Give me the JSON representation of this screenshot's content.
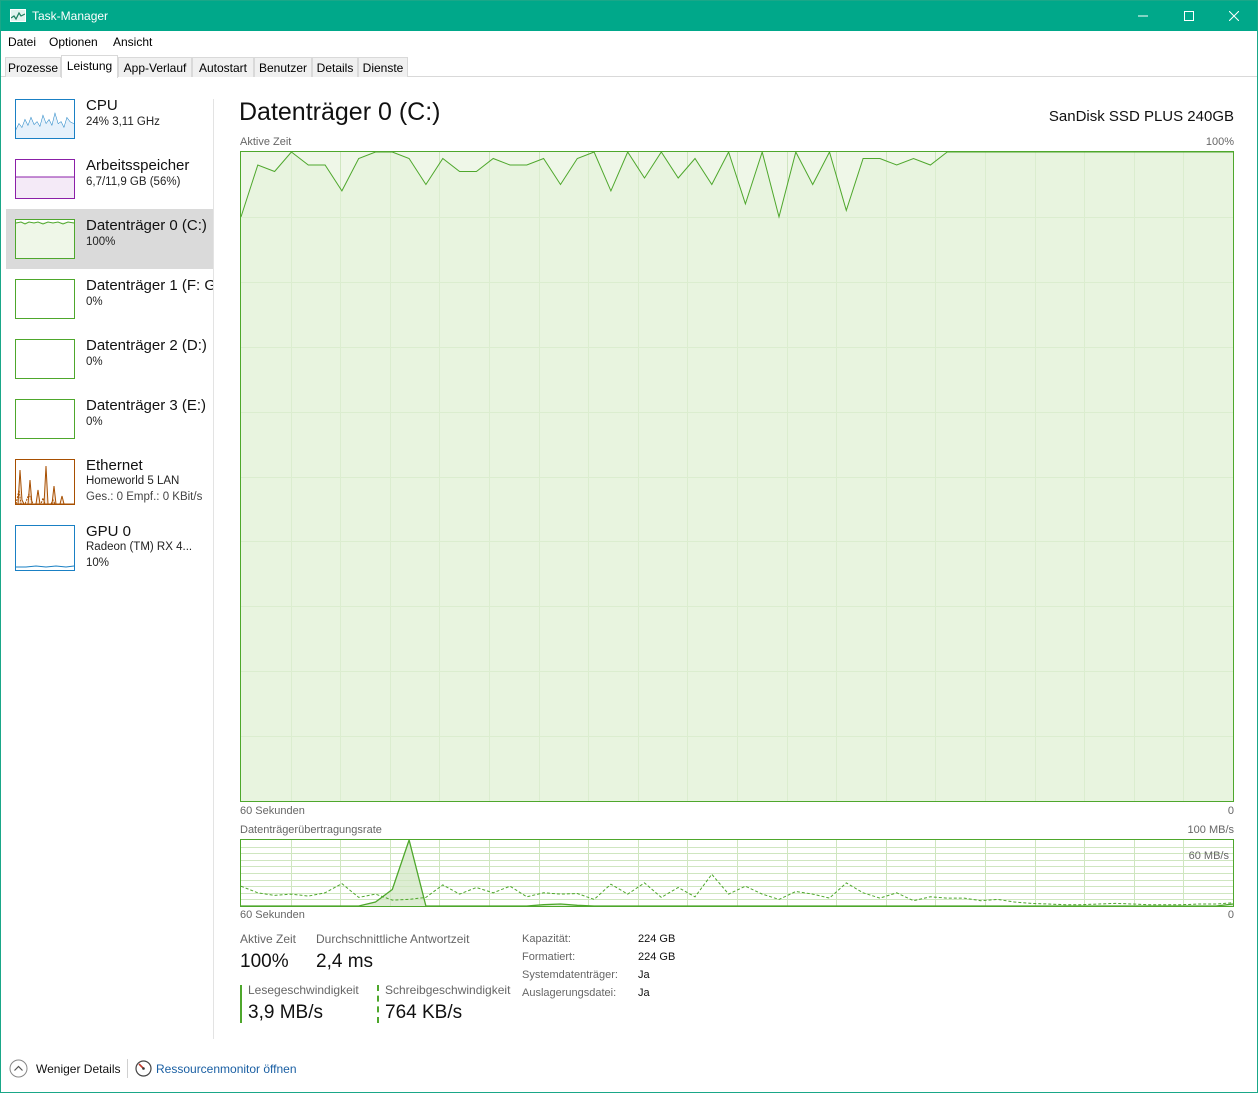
{
  "window": {
    "title": "Task-Manager"
  },
  "menu": [
    "Datei",
    "Optionen",
    "Ansicht"
  ],
  "tabs": [
    "Prozesse",
    "Leistung",
    "App-Verlauf",
    "Autostart",
    "Benutzer",
    "Details",
    "Dienste"
  ],
  "active_tab": "Leistung",
  "sidebar": [
    {
      "title": "CPU",
      "sub1": "24%  3,11 GHz",
      "sub2": "",
      "color": "#1a80c4"
    },
    {
      "title": "Arbeitsspeicher",
      "sub1": "6,7/11,9 GB (56%)",
      "sub2": "",
      "color": "#8b1fa8"
    },
    {
      "title": "Datenträger 0 (C:)",
      "sub1": "100%",
      "sub2": "",
      "color": "#4ea72c"
    },
    {
      "title": "Datenträger 1 (F: G",
      "sub1": "0%",
      "sub2": "",
      "color": "#4ea72c"
    },
    {
      "title": "Datenträger 2 (D:)",
      "sub1": "0%",
      "sub2": "",
      "color": "#4ea72c"
    },
    {
      "title": "Datenträger 3 (E:)",
      "sub1": "0%",
      "sub2": "",
      "color": "#4ea72c"
    },
    {
      "title": "Ethernet",
      "sub1": "Homeworld 5 LAN",
      "sub2": "Ges.: 0  Empf.: 0 KBit/s",
      "color": "#a74f01"
    },
    {
      "title": "GPU 0",
      "sub1": "Radeon (TM) RX 4...",
      "sub2": "10%",
      "color": "#1a80c4"
    }
  ],
  "main": {
    "title": "Datenträger 0 (C:)",
    "model": "SanDisk SSD PLUS 240GB",
    "chart1_label": "Aktive Zeit",
    "chart1_max": "100%",
    "chart1_xleft": "60 Sekunden",
    "chart1_xright": "0",
    "chart2_label": "Datenträgerübertragungsrate",
    "chart2_max": "100 MB/s",
    "chart2_mid": "60 MB/s",
    "chart2_xleft": "60 Sekunden",
    "chart2_xright": "0"
  },
  "stats": {
    "active_time_label": "Aktive Zeit",
    "active_time": "100%",
    "response_label": "Durchschnittliche Antwortzeit",
    "response": "2,4 ms",
    "read_label": "Lesegeschwindigkeit",
    "read": "3,9 MB/s",
    "write_label": "Schreibgeschwindigkeit",
    "write": "764 KB/s",
    "props": [
      {
        "key": "Kapazität:",
        "value": "224 GB"
      },
      {
        "key": "Formatiert:",
        "value": "224 GB"
      },
      {
        "key": "Systemdatenträger:",
        "value": "Ja"
      },
      {
        "key": "Auslagerungsdatei:",
        "value": "Ja"
      }
    ]
  },
  "footer": {
    "less_details": "Weniger Details",
    "resource_monitor": "Ressourcenmonitor öffnen"
  },
  "chart_data": [
    {
      "type": "area",
      "title": "Aktive Zeit",
      "xlabel": "60 Sekunden",
      "ylim": [
        0,
        100
      ],
      "unit": "%",
      "values": [
        90,
        98,
        97,
        100,
        98,
        98,
        94,
        99,
        100,
        100,
        99,
        95,
        99,
        97,
        97,
        99,
        98,
        98,
        99,
        95,
        99,
        100,
        94,
        100,
        96,
        100,
        96,
        99,
        95,
        100,
        92,
        100,
        90,
        100,
        95,
        100,
        91,
        99,
        99,
        98,
        99,
        98,
        100,
        100,
        100,
        100,
        100,
        100,
        100,
        100,
        100,
        100,
        100,
        100,
        100,
        100,
        100,
        100,
        100,
        100
      ]
    },
    {
      "type": "line",
      "title": "Datenträgerübertragungsrate",
      "xlabel": "60 Sekunden",
      "ylim": [
        0,
        100
      ],
      "unit": "MB/s",
      "series": [
        {
          "values": [
            0,
            0,
            0,
            0,
            0,
            0,
            0,
            0,
            6,
            25,
            100,
            0,
            0,
            0,
            0,
            0,
            0,
            0,
            2,
            3,
            1,
            0,
            0,
            0,
            0,
            0,
            0,
            0,
            0,
            0,
            0,
            0,
            0,
            0,
            0,
            0,
            0,
            0,
            0,
            0,
            0,
            0,
            0,
            0,
            0,
            0,
            0,
            0,
            0,
            0,
            0,
            0,
            0,
            0,
            0,
            0,
            0,
            0,
            0,
            3
          ]
        },
        {
          "values": [
            30,
            20,
            16,
            18,
            15,
            20,
            34,
            13,
            18,
            9,
            10,
            13,
            32,
            18,
            28,
            20,
            30,
            14,
            20,
            18,
            19,
            10,
            33,
            18,
            35,
            13,
            28,
            14,
            48,
            18,
            30,
            18,
            10,
            22,
            18,
            12,
            35,
            20,
            12,
            20,
            8,
            14,
            12,
            12,
            8,
            10,
            6,
            4,
            3,
            2,
            2,
            3,
            4,
            3,
            2,
            2,
            2,
            3,
            3,
            5
          ]
        }
      ]
    }
  ]
}
